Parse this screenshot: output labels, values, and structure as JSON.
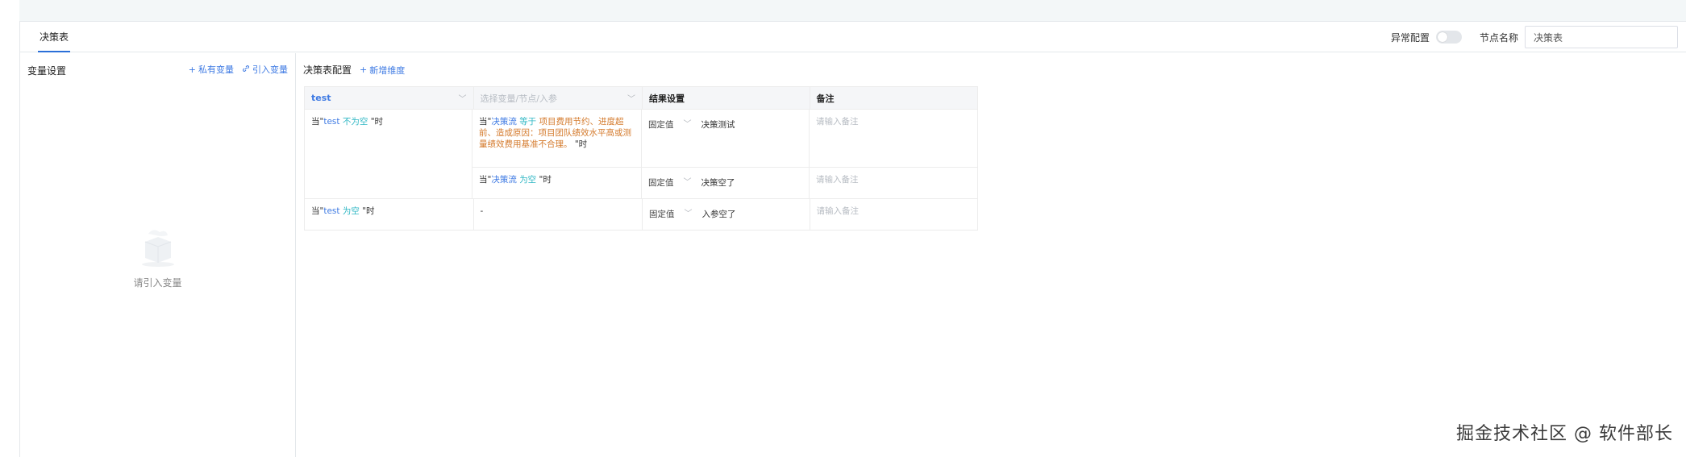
{
  "tabs": {
    "active": "决策表"
  },
  "node": {
    "exception_label": "异常配置",
    "name_label": "节点名称",
    "name_value": "决策表"
  },
  "var_panel": {
    "title": "变量设置",
    "private_var": "私有变量",
    "import_var": "引入变量",
    "empty_text": "请引入变量"
  },
  "config": {
    "title": "决策表配置",
    "add_dimension": "新增维度"
  },
  "table": {
    "headers": {
      "col1": "test",
      "col2_placeholder": "选择变量/节点/入参",
      "col3": "结果设置",
      "col4": "备注"
    },
    "rows": [
      {
        "cond1_prefix": "当\"",
        "cond1_var": "test",
        "cond1_op": "不为空",
        "cond1_suffix": "\"时",
        "sub": [
          {
            "prefix": "当\"",
            "var": "决策流",
            "op": "等于",
            "value": "项目费用节约、进度超前、造成原因：项目团队绩效水平高或测量绩效费用基准不合理。",
            "suffix": "\"时",
            "type": "固定值",
            "result": "决策测试",
            "remark_placeholder": "请输入备注"
          },
          {
            "prefix": "当\"",
            "var": "决策流",
            "op": "为空",
            "value": "",
            "suffix": "\"时",
            "type": "固定值",
            "result": "决策空了",
            "remark_placeholder": "请输入备注"
          }
        ]
      },
      {
        "cond1_prefix": "当\"",
        "cond1_var": "test",
        "cond1_op": "为空",
        "cond1_suffix": "\"时",
        "sub": [
          {
            "dash": "-",
            "type": "固定值",
            "result": "入参空了",
            "remark_placeholder": "请输入备注"
          }
        ]
      }
    ]
  },
  "watermark": "掘金技术社区 @ 软件部长"
}
